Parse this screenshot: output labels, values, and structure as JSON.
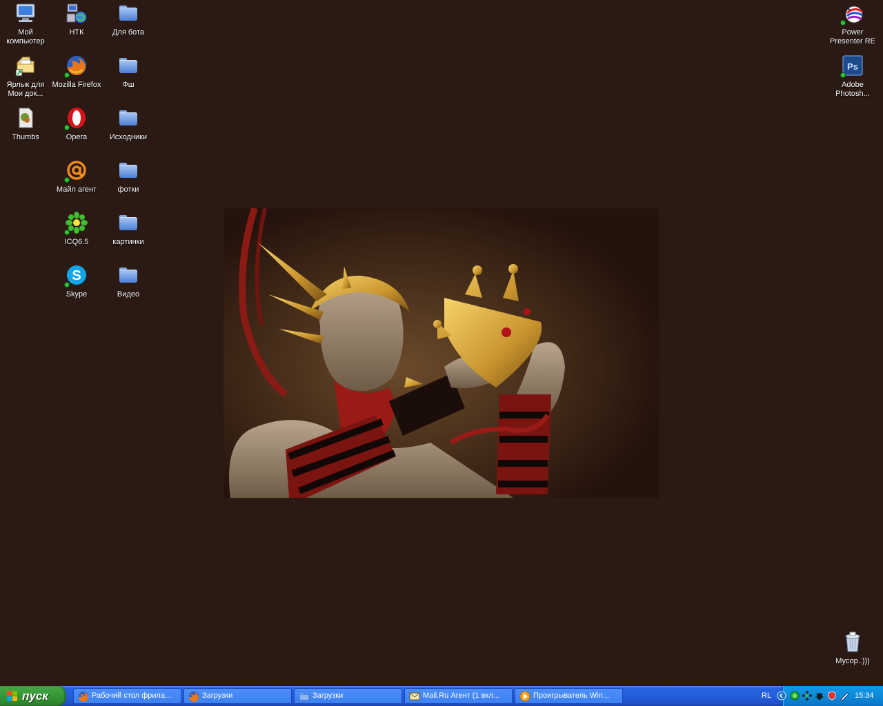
{
  "desktop_icons": [
    {
      "label": "Мой\nкомпьютер",
      "icon": "my-computer-icon"
    },
    {
      "label": "НТК",
      "icon": "network-computers-icon"
    },
    {
      "label": "Для бота",
      "icon": "folder-icon"
    },
    {
      "label": "Ярлык для\nМои док...",
      "icon": "shortcut-documents-icon"
    },
    {
      "label": "Mozilla Firefox",
      "icon": "firefox-icon"
    },
    {
      "label": "Фш",
      "icon": "folder-icon"
    },
    {
      "label": "Thumbs",
      "icon": "thumbs-file-icon"
    },
    {
      "label": "Opera",
      "icon": "opera-icon"
    },
    {
      "label": "Исходники",
      "icon": "folder-icon"
    },
    {
      "label": "Майл агент",
      "icon": "mail-agent-icon"
    },
    {
      "label": "фотки",
      "icon": "folder-icon"
    },
    {
      "label": "ICQ6.5",
      "icon": "icq-icon"
    },
    {
      "label": "картинки",
      "icon": "folder-icon"
    },
    {
      "label": "Skype",
      "icon": "skype-icon"
    },
    {
      "label": "Видео",
      "icon": "folder-icon"
    },
    {
      "label": "Power\nPresenter RE",
      "icon": "power-presenter-icon"
    },
    {
      "label": "Adobe\nPhotosh...",
      "icon": "photoshop-icon"
    },
    {
      "label": "Мусор..)))",
      "icon": "recycle-bin-icon"
    }
  ],
  "taskbar": {
    "start_label": "пуск",
    "tasks": [
      {
        "label": "Рабочий стол фрила...",
        "icon": "firefox-icon"
      },
      {
        "label": "Загрузки",
        "icon": "firefox-icon"
      },
      {
        "label": "Загрузки",
        "icon": "folder-icon"
      },
      {
        "label": "Mail.Ru Агент (1 вкл...",
        "icon": "mail-envelope-icon"
      },
      {
        "label": "Проигрыватель Win...",
        "icon": "media-player-icon"
      }
    ],
    "language": "RL",
    "clock": "15:34"
  },
  "colors": {
    "desktop_bg": "#2b1913",
    "taskbar_blue": "#245edc",
    "start_green": "#389a39",
    "tray_blue": "#0e8ad8"
  }
}
